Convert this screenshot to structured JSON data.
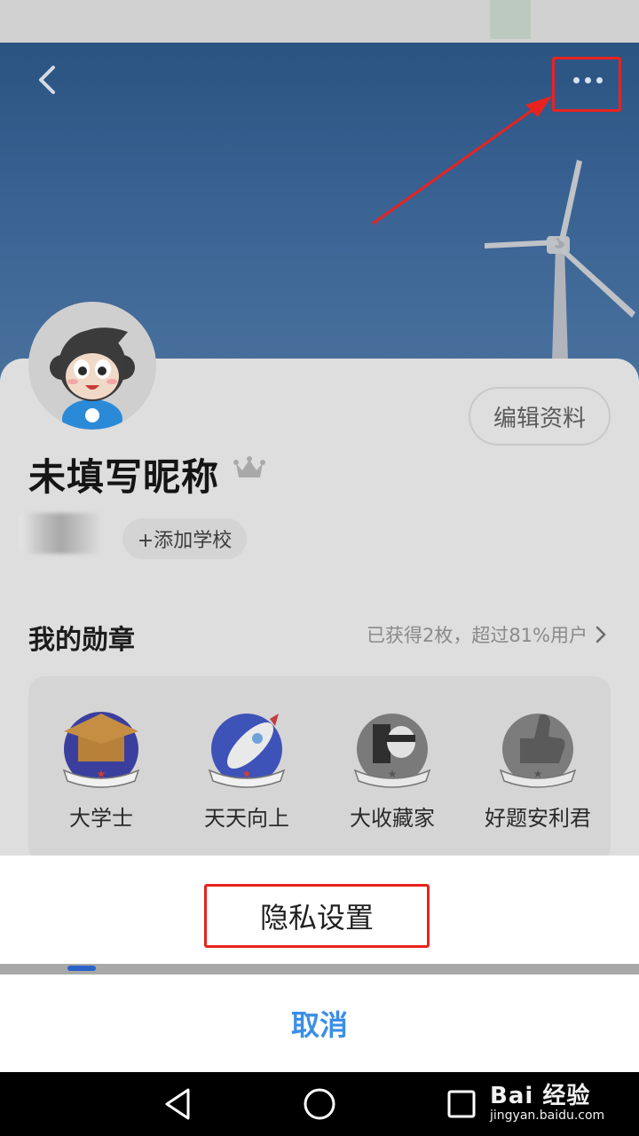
{
  "header": {
    "back_icon": "chevron-left-icon",
    "more_icon": "more-horizontal-icon"
  },
  "profile": {
    "nickname": "未填写昵称",
    "edit_label": "编辑资料",
    "add_school_label": "+添加学校"
  },
  "medals": {
    "title": "我的勋章",
    "summary": "已获得2枚，超过81%用户",
    "items": [
      {
        "label": "大学士"
      },
      {
        "label": "天天向上"
      },
      {
        "label": "大收藏家"
      },
      {
        "label": "好题安利君"
      }
    ]
  },
  "sheet": {
    "privacy_label": "隐私设置",
    "cancel_label": "取消"
  },
  "watermark": {
    "main": "Bai 经验",
    "sub": "jingyan.baidu.com"
  },
  "colors": {
    "highlight": "#e8231f",
    "cancel": "#3a8ee6"
  }
}
